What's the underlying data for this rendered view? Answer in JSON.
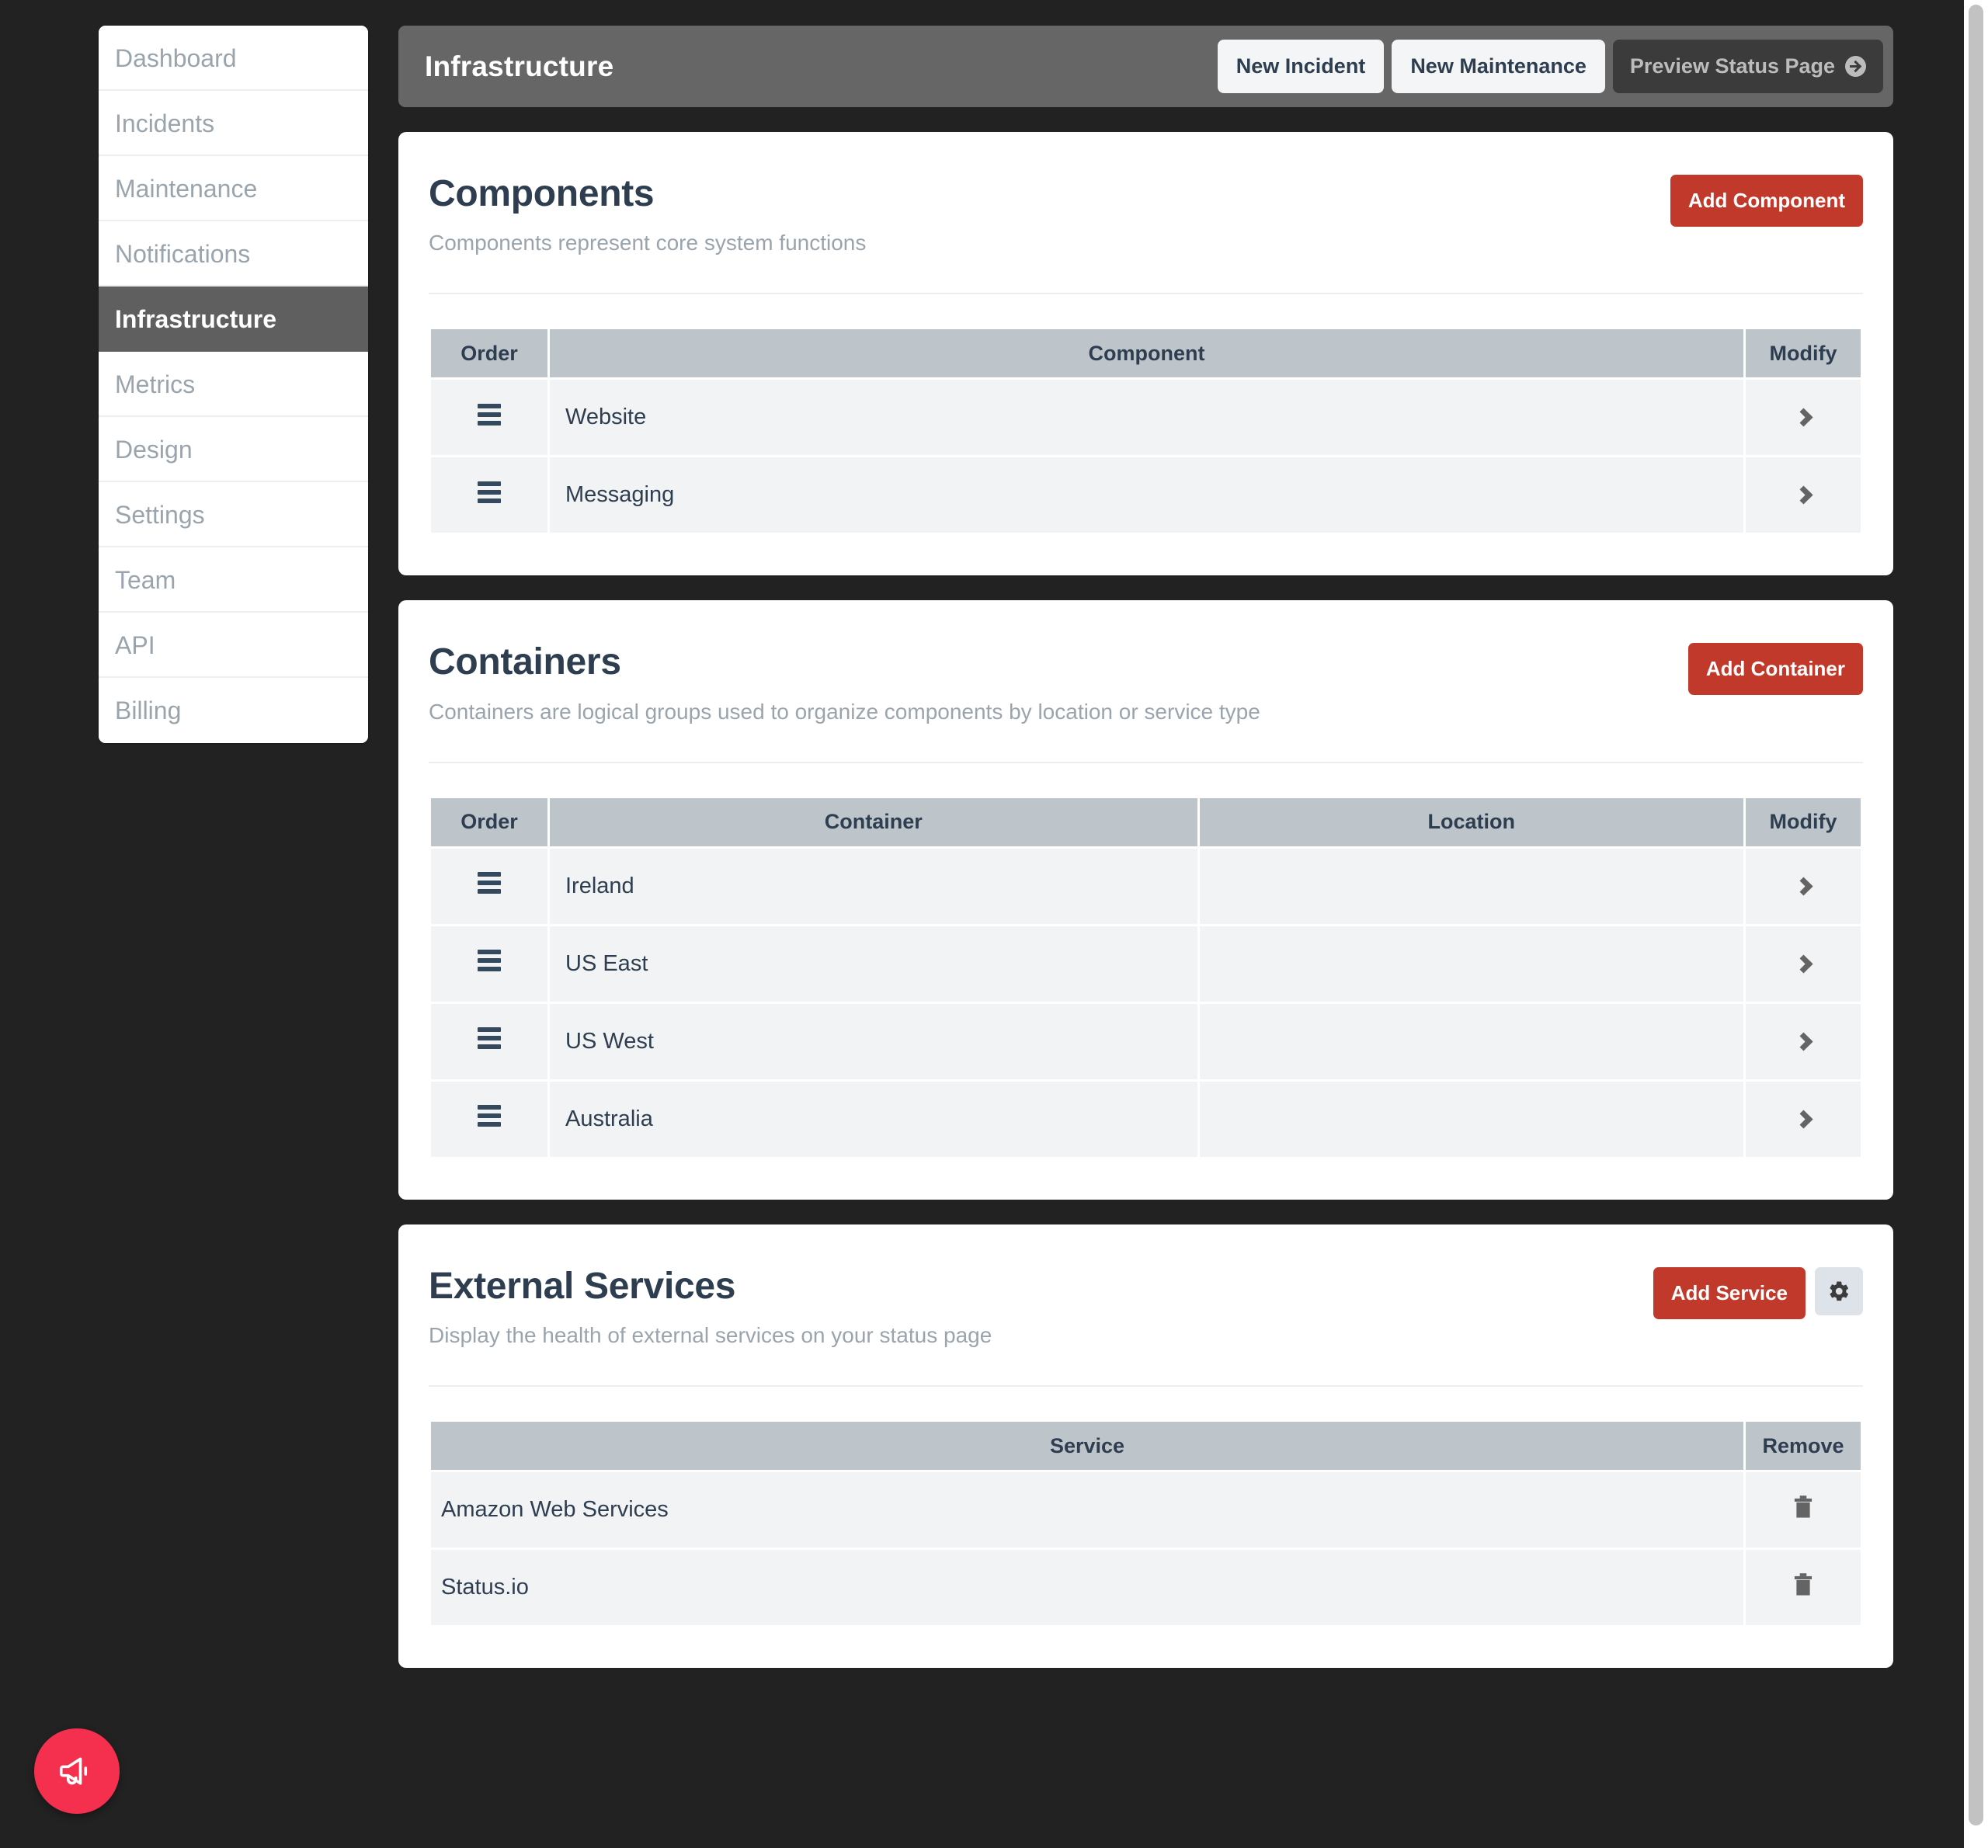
{
  "theme": {
    "page_bg": "#222222",
    "accent_red": "#c0392b",
    "fab_red": "#f5304f",
    "header_gray": "#666666",
    "active_nav": "#5f5f5f",
    "table_header": "#bdc5cb",
    "table_row": "#f1f3f5",
    "text_dark": "#2e3e50",
    "text_muted": "#9aa4ad"
  },
  "sidebar": {
    "items": [
      {
        "label": "Dashboard",
        "active": false
      },
      {
        "label": "Incidents",
        "active": false
      },
      {
        "label": "Maintenance",
        "active": false
      },
      {
        "label": "Notifications",
        "active": false
      },
      {
        "label": "Infrastructure",
        "active": true
      },
      {
        "label": "Metrics",
        "active": false
      },
      {
        "label": "Design",
        "active": false
      },
      {
        "label": "Settings",
        "active": false
      },
      {
        "label": "Team",
        "active": false
      },
      {
        "label": "API",
        "active": false
      },
      {
        "label": "Billing",
        "active": false
      }
    ]
  },
  "header": {
    "title": "Infrastructure",
    "new_incident_label": "New Incident",
    "new_maintenance_label": "New Maintenance",
    "preview_label": "Preview Status Page",
    "preview_icon": "arrow-right-circle-icon"
  },
  "components": {
    "title": "Components",
    "subtitle": "Components represent core system functions",
    "add_label": "Add Component",
    "columns": [
      "Order",
      "Component",
      "Modify"
    ],
    "rows": [
      {
        "order_icon": "drag-handle-icon",
        "name": "Website",
        "modify_icon": "chevron-right-icon"
      },
      {
        "order_icon": "drag-handle-icon",
        "name": "Messaging",
        "modify_icon": "chevron-right-icon"
      }
    ]
  },
  "containers": {
    "title": "Containers",
    "subtitle": "Containers are logical groups used to organize components by location or service type",
    "add_label": "Add Container",
    "columns": [
      "Order",
      "Container",
      "Location",
      "Modify"
    ],
    "rows": [
      {
        "order_icon": "drag-handle-icon",
        "name": "Ireland",
        "location": "",
        "modify_icon": "chevron-right-icon"
      },
      {
        "order_icon": "drag-handle-icon",
        "name": "US East",
        "location": "",
        "modify_icon": "chevron-right-icon"
      },
      {
        "order_icon": "drag-handle-icon",
        "name": "US West",
        "location": "",
        "modify_icon": "chevron-right-icon"
      },
      {
        "order_icon": "drag-handle-icon",
        "name": "Australia",
        "location": "",
        "modify_icon": "chevron-right-icon"
      }
    ]
  },
  "external_services": {
    "title": "External Services",
    "subtitle": "Display the health of external services on your status page",
    "add_label": "Add Service",
    "settings_icon": "gear-icon",
    "columns": [
      "Service",
      "Remove"
    ],
    "rows": [
      {
        "name": "Amazon Web Services",
        "remove_icon": "trash-icon"
      },
      {
        "name": "Status.io",
        "remove_icon": "trash-icon"
      }
    ]
  },
  "fab": {
    "icon": "megaphone-icon",
    "label": ""
  }
}
